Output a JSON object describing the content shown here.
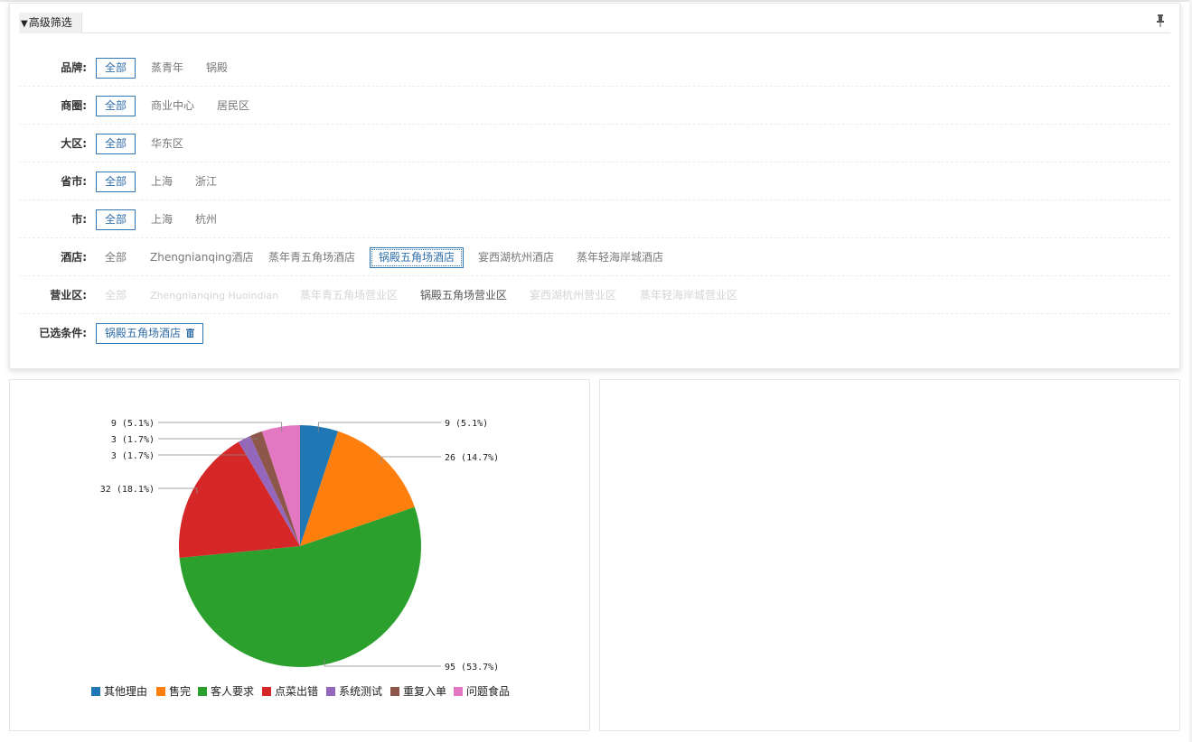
{
  "filter": {
    "title": "高级筛选",
    "rows": [
      {
        "label": "品牌:",
        "options": [
          "全部",
          "蒸青年",
          "锅殿"
        ],
        "selected": 0
      },
      {
        "label": "商圈:",
        "options": [
          "全部",
          "商业中心",
          "居民区"
        ],
        "selected": 0
      },
      {
        "label": "大区:",
        "options": [
          "全部",
          "华东区"
        ],
        "selected": 0
      },
      {
        "label": "省市:",
        "options": [
          "全部",
          "上海",
          "浙江"
        ],
        "selected": 0
      },
      {
        "label": "市:",
        "options": [
          "全部",
          "上海",
          "杭州"
        ],
        "selected": 0
      },
      {
        "label": "酒店:",
        "options": [
          "全部",
          "Zhengnianqing酒店",
          "蒸年青五角场酒店",
          "锅殿五角场酒店",
          "宴西湖杭州酒店",
          "蒸年轻海岸城酒店"
        ],
        "selected": 3
      },
      {
        "label": "营业区:",
        "options": [
          "全部",
          "Zhengnianqing Huoindian",
          "蒸年青五角场营业区",
          "锅殿五角场营业区",
          "宴西湖杭州营业区",
          "蒸年轻海岸城营业区"
        ],
        "enabled": 3
      },
      {
        "label": "已选条件:",
        "tags": [
          "锅殿五角场酒店"
        ]
      }
    ]
  },
  "chart_data": {
    "type": "pie",
    "title": "",
    "categories": [
      "其他理由",
      "售完",
      "客人要求",
      "点菜出错",
      "系统测试",
      "重复入单",
      "问题食品"
    ],
    "values": [
      9,
      26,
      95,
      32,
      3,
      3,
      9
    ],
    "data_labels": [
      "9 (5.1%)",
      "26 (14.7%)",
      "95 (53.7%)",
      "32 (18.1%)",
      "3 (1.7%)",
      "3 (1.7%)",
      "9 (5.1%)"
    ],
    "colors": [
      "#1f77b4",
      "#ff7f0e",
      "#2ca02c",
      "#d62728",
      "#9467bd",
      "#8c564b",
      "#e377c2"
    ],
    "legend_position": "bottom"
  }
}
